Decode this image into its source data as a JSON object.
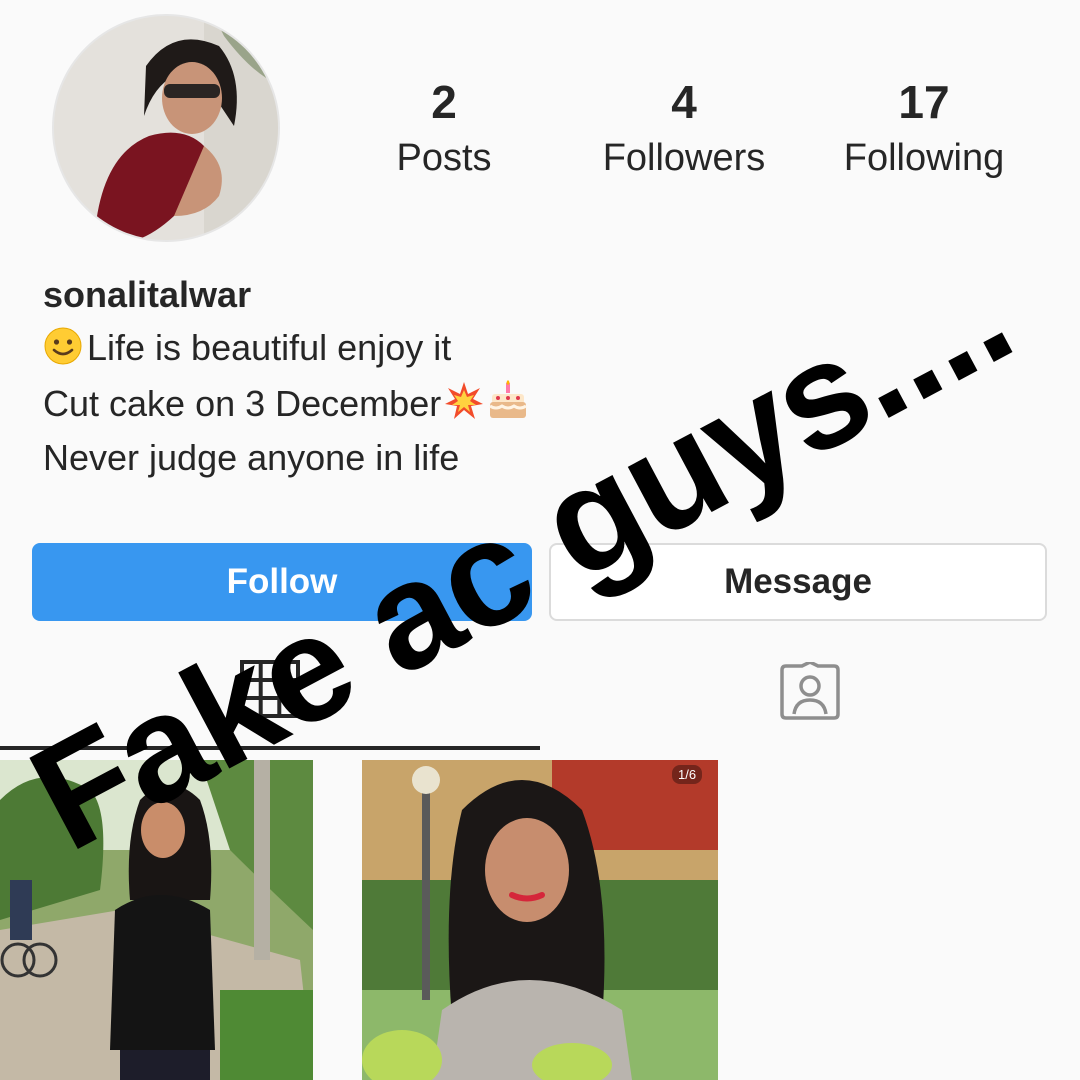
{
  "profile": {
    "username": "sonalitalwar",
    "stats": [
      {
        "value": "2",
        "label": "Posts"
      },
      {
        "value": "4",
        "label": "Followers"
      },
      {
        "value": "17",
        "label": "Following"
      }
    ],
    "bio": {
      "line1_emoji": "slightly-smiling-face-emoji",
      "line1": "Life is beautiful enjoy it",
      "line2": "Cut cake on 3 December",
      "line2_emojis": [
        "collision-emoji",
        "birthday-cake-emoji"
      ],
      "line3": "Never judge anyone in life"
    }
  },
  "actions": {
    "follow_label": "Follow",
    "message_label": "Message"
  },
  "tabs": {
    "grid_icon": "grid-icon",
    "tagged_icon": "tagged-person-icon"
  },
  "posts": {
    "second_post_badge": "1/6"
  },
  "overlay": {
    "text": "Fake ac guys...."
  },
  "colors": {
    "follow_button": "#3897f0",
    "background": "#fafafa",
    "text": "#262626",
    "border": "#dbdbdb",
    "overlay_text": "#000000"
  }
}
